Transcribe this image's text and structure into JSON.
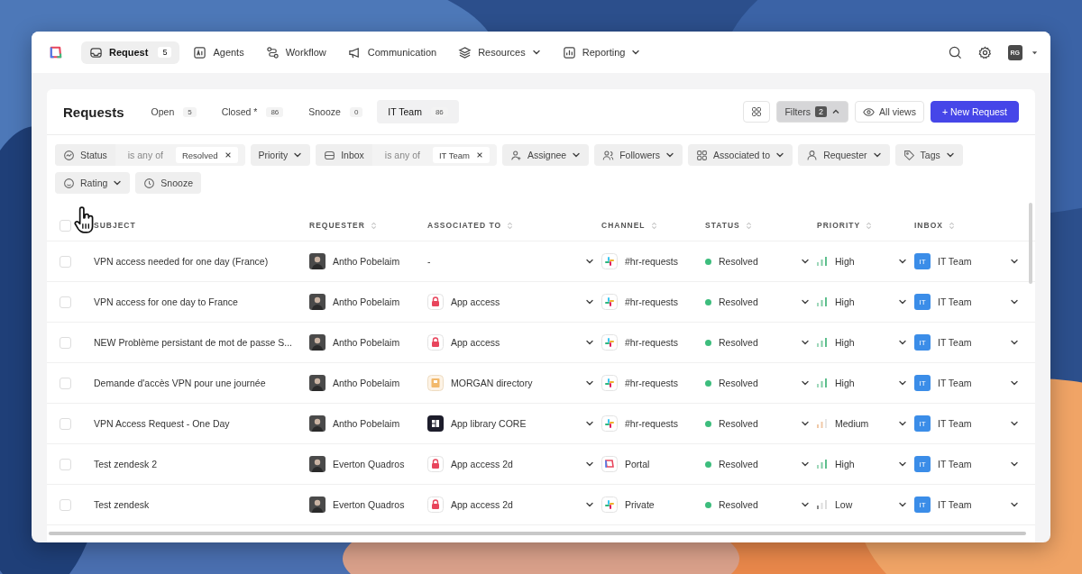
{
  "nav": {
    "items": [
      {
        "label": "Request",
        "badge": "5",
        "dropdown": false,
        "selected": true
      },
      {
        "label": "Agents",
        "dropdown": false,
        "selected": false
      },
      {
        "label": "Workflow",
        "dropdown": false,
        "selected": false
      },
      {
        "label": "Communication",
        "dropdown": false,
        "selected": false
      },
      {
        "label": "Resources",
        "dropdown": true,
        "selected": false
      },
      {
        "label": "Reporting",
        "dropdown": true,
        "selected": false
      }
    ],
    "avatar": "RG"
  },
  "page": {
    "title": "Requests",
    "tabs": [
      {
        "label": "Open",
        "count": "5",
        "selected": false
      },
      {
        "label": "Closed *",
        "count": "86",
        "selected": false
      },
      {
        "label": "Snooze",
        "count": "0",
        "selected": false
      },
      {
        "label": "IT Team",
        "count": "86",
        "selected": true
      }
    ],
    "filters_button": {
      "label": "Filters",
      "count": "2",
      "expanded": true
    },
    "views_button": "All views",
    "new_button": "+ New Request"
  },
  "filters": [
    {
      "kind": "condition",
      "label": "Status",
      "operator": "is any of",
      "value": "Resolved"
    },
    {
      "kind": "dropdown",
      "label": "Priority",
      "chevron": true
    },
    {
      "kind": "condition",
      "label": "Inbox",
      "operator": "is any of",
      "value": "IT Team"
    },
    {
      "kind": "dropdown",
      "label": "Assignee",
      "chevron": true
    },
    {
      "kind": "dropdown",
      "label": "Followers",
      "chevron": true
    },
    {
      "kind": "dropdown",
      "label": "Associated to",
      "chevron": true
    },
    {
      "kind": "dropdown",
      "label": "Requester",
      "chevron": true
    },
    {
      "kind": "dropdown",
      "label": "Tags",
      "chevron": true
    },
    {
      "kind": "dropdown",
      "label": "Rating",
      "chevron": true
    },
    {
      "kind": "dropdown",
      "label": "Snooze",
      "chevron": false
    }
  ],
  "table": {
    "select_all_checked": false,
    "columns": [
      {
        "label": "SUBJECT",
        "sortable": false
      },
      {
        "label": "REQUESTER",
        "sortable": true
      },
      {
        "label": "ASSOCIATED TO",
        "sortable": true
      },
      {
        "label": "CHANNEL",
        "sortable": true
      },
      {
        "label": "STATUS",
        "sortable": true
      },
      {
        "label": "PRIORITY",
        "sortable": true
      },
      {
        "label": "INBOX",
        "sortable": true
      }
    ],
    "rows": [
      {
        "checked": false,
        "subject": "VPN access needed for one day (France)",
        "requester": "Antho Pobelaim",
        "associated": {
          "kind": "none",
          "label": "-"
        },
        "channel": {
          "kind": "slack",
          "label": "#hr-requests"
        },
        "status": {
          "label": "Resolved",
          "color": "#3dbd7d"
        },
        "priority": {
          "kind": "high",
          "label": "High"
        },
        "inbox": {
          "badge": "IT",
          "label": "IT Team"
        }
      },
      {
        "checked": false,
        "subject": "VPN access for one day to France",
        "requester": "Antho Pobelaim",
        "associated": {
          "kind": "lock",
          "label": "App access"
        },
        "channel": {
          "kind": "slack",
          "label": "#hr-requests"
        },
        "status": {
          "label": "Resolved",
          "color": "#3dbd7d"
        },
        "priority": {
          "kind": "high",
          "label": "High"
        },
        "inbox": {
          "badge": "IT",
          "label": "IT Team"
        }
      },
      {
        "checked": false,
        "subject": "NEW Problème persistant de mot de passe S...",
        "requester": "Antho Pobelaim",
        "associated": {
          "kind": "lock",
          "label": "App access"
        },
        "channel": {
          "kind": "slack",
          "label": "#hr-requests"
        },
        "status": {
          "label": "Resolved",
          "color": "#3dbd7d"
        },
        "priority": {
          "kind": "high",
          "label": "High"
        },
        "inbox": {
          "badge": "IT",
          "label": "IT Team"
        }
      },
      {
        "checked": false,
        "subject": "Demande d'accès VPN pour une journée",
        "requester": "Antho Pobelaim",
        "associated": {
          "kind": "folder",
          "label": "MORGAN directory"
        },
        "channel": {
          "kind": "slack",
          "label": "#hr-requests"
        },
        "status": {
          "label": "Resolved",
          "color": "#3dbd7d"
        },
        "priority": {
          "kind": "high",
          "label": "High"
        },
        "inbox": {
          "badge": "IT",
          "label": "IT Team"
        }
      },
      {
        "checked": false,
        "subject": "VPN Access Request - One Day",
        "requester": "Antho Pobelaim",
        "associated": {
          "kind": "library",
          "label": "App library CORE"
        },
        "channel": {
          "kind": "slack",
          "label": "#hr-requests"
        },
        "status": {
          "label": "Resolved",
          "color": "#3dbd7d"
        },
        "priority": {
          "kind": "medium",
          "label": "Medium"
        },
        "inbox": {
          "badge": "IT",
          "label": "IT Team"
        }
      },
      {
        "checked": false,
        "subject": "Test zendesk 2",
        "requester": "Everton Quadros",
        "associated": {
          "kind": "lock",
          "label": "App access 2d"
        },
        "channel": {
          "kind": "portal",
          "label": "Portal"
        },
        "status": {
          "label": "Resolved",
          "color": "#3dbd7d"
        },
        "priority": {
          "kind": "high",
          "label": "High"
        },
        "inbox": {
          "badge": "IT",
          "label": "IT Team"
        }
      },
      {
        "checked": false,
        "subject": "Test zendesk",
        "requester": "Everton Quadros",
        "associated": {
          "kind": "lock",
          "label": "App access 2d"
        },
        "channel": {
          "kind": "slack",
          "label": "Private"
        },
        "status": {
          "label": "Resolved",
          "color": "#3dbd7d"
        },
        "priority": {
          "kind": "low",
          "label": "Low"
        },
        "inbox": {
          "badge": "IT",
          "label": "IT Team"
        }
      }
    ]
  }
}
